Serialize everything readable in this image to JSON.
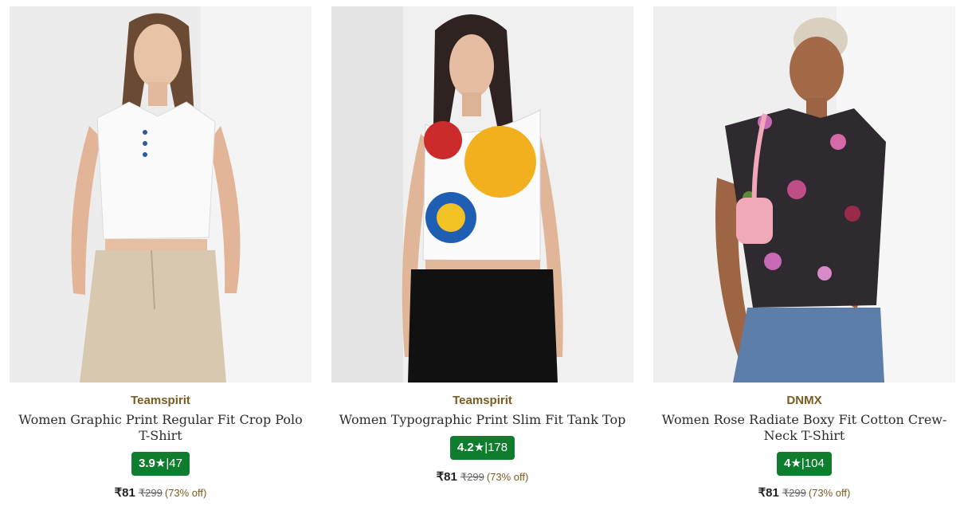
{
  "products": [
    {
      "brand": "Teamspirit",
      "title": "Women Graphic Print Regular Fit Crop Polo T-Shirt",
      "rating": "3.9",
      "reviews": "47",
      "price": "₹81",
      "mrp": "₹299",
      "discount": "(73% off)"
    },
    {
      "brand": "Teamspirit",
      "title": "Women Typographic Print Slim Fit Tank Top",
      "rating": "4.2",
      "reviews": "178",
      "price": "₹81",
      "mrp": "₹299",
      "discount": "(73% off)"
    },
    {
      "brand": "DNMX",
      "title": "Women Rose Radiate Boxy Fit Cotton Crew-Neck T-Shirt",
      "rating": "4",
      "reviews": "104",
      "price": "₹81",
      "mrp": "₹299",
      "discount": "(73% off)"
    }
  ],
  "symbols": {
    "star": "★",
    "separator": "|"
  },
  "colors": {
    "brand": "#7a5b22",
    "rating_bg": "#0f7d2e"
  }
}
